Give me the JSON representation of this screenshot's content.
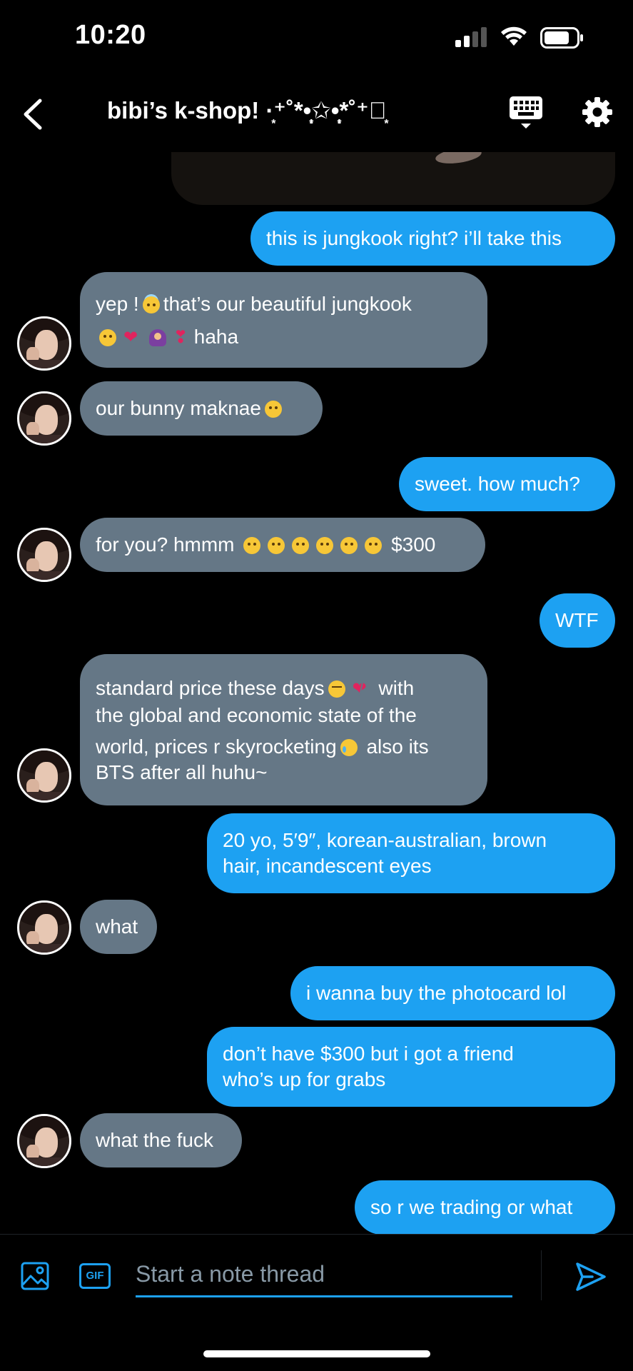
{
  "status_bar": {
    "time": "10:20"
  },
  "header": {
    "title": "bibi’s k-shop! ·͙⁺˚*•̩̩͙✩•̩̩͙*˚⁺‧͙"
  },
  "messages": [
    {
      "direction": "out",
      "text": "this is jungkook right? i’ll take this"
    },
    {
      "direction": "in",
      "lines": [
        "yep ! [halo-emoji] that’s our beautiful jungkook",
        "[emojis] haha"
      ],
      "line_1": "yep !",
      "line_1b": "that’s our beautiful jungkook",
      "line_2": "haha"
    },
    {
      "direction": "in",
      "text": "our bunny maknae"
    },
    {
      "direction": "out",
      "text": "sweet. how much?"
    },
    {
      "direction": "in",
      "text_a": "for you? hmmm",
      "text_b": "$300"
    },
    {
      "direction": "out",
      "text": "WTF"
    },
    {
      "direction": "in",
      "line_1a": "standard price these days",
      "line_1b": "with",
      "line_2": "the global and economic state of the",
      "line_3a": "world, prices r skyrocketing",
      "line_3b": "also its",
      "line_4": "BTS after all huhu~"
    },
    {
      "direction": "out",
      "line_1": "20 yo, 5′9″, korean-australian, brown",
      "line_2": "hair, incandescent eyes"
    },
    {
      "direction": "in",
      "text": "what"
    },
    {
      "direction": "out",
      "text": "i wanna buy the photocard lol"
    },
    {
      "direction": "out",
      "line_1": "don’t have $300 but i got a friend",
      "line_2": "who’s up for grabs"
    },
    {
      "direction": "in",
      "text": "what the fuck"
    },
    {
      "direction": "out",
      "text": "so r we trading or what"
    }
  ],
  "composer": {
    "placeholder": "Start a note thread",
    "gif_label": "GIF"
  },
  "icons": {
    "back": "chevron-left-icon",
    "keyboard": "keyboard-icon",
    "settings": "gear-icon",
    "image": "image-icon",
    "gif": "gif-icon",
    "send": "send-icon"
  },
  "colors": {
    "background": "#000000",
    "outgoing_bubble": "#1da1f2",
    "incoming_bubble": "#657786",
    "accent": "#1da1f2",
    "placeholder": "#8899a6"
  }
}
